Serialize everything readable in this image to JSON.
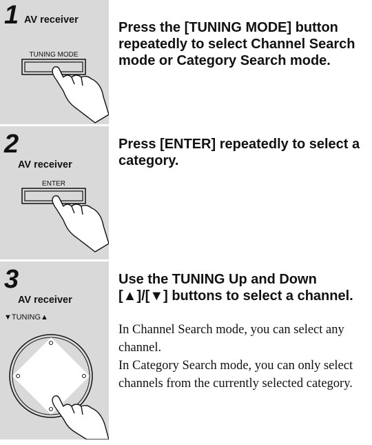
{
  "steps": [
    {
      "number": "1",
      "source": "AV receiver",
      "button_label": "TUNING MODE",
      "instruction": "Press the [TUNING MODE] button repeatedly to select Channel Search mode or Category Search mode.",
      "icons": [
        "tuning-mode-button-icon",
        "pointing-hand-icon"
      ]
    },
    {
      "number": "2",
      "source": "AV receiver",
      "button_label": "ENTER",
      "instruction": "Press [ENTER] repeatedly to select a category.",
      "icons": [
        "enter-button-icon",
        "pointing-hand-icon"
      ]
    },
    {
      "number": "3",
      "source": "AV receiver",
      "button_label": "▼TUNING▲",
      "instruction": "Use the TUNING Up and Down [▲]/[▼] buttons to select a channel.",
      "details": [
        "In Channel Search mode, you can select any channel.",
        "In Category Search mode, you can only select channels from the currently selected category."
      ],
      "icons": [
        "tuning-dial-icon",
        "pointing-hand-icon"
      ]
    }
  ],
  "colors": {
    "sidebar": "#d9d9d9",
    "text": "#111111"
  }
}
